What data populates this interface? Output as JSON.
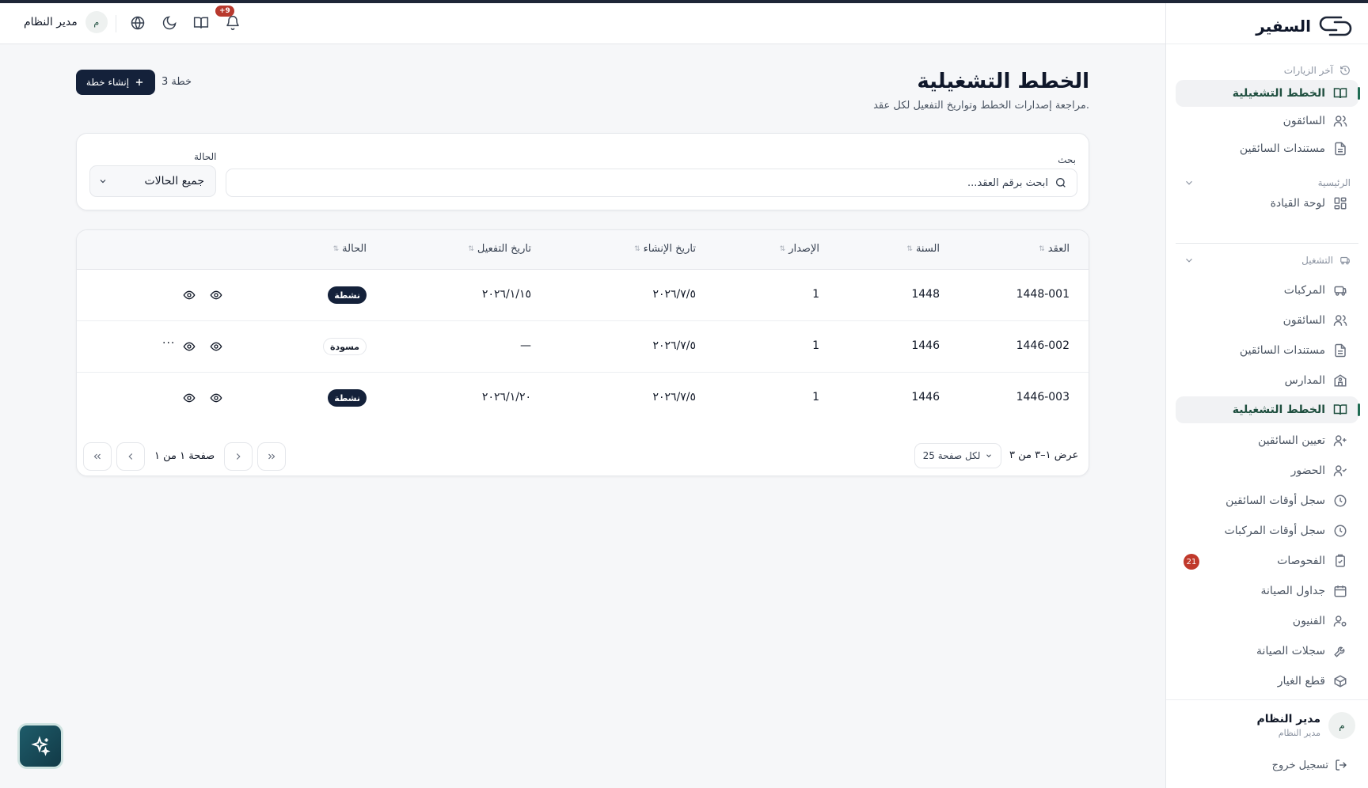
{
  "brand": {
    "name": "السفير"
  },
  "topbar": {
    "user_name": "مدير النظام",
    "user_initial": "م",
    "notification_badge": "+9"
  },
  "sidebar": {
    "recent_label": "آخر الزيارات",
    "recent_items": [
      {
        "label": "الخطط التشغيلية",
        "icon": "book-open-icon",
        "active": true
      },
      {
        "label": "السائقون",
        "icon": "users-icon"
      },
      {
        "label": "مستندات السائقين",
        "icon": "file-text-icon"
      }
    ],
    "main_label": "الرئيسية",
    "main_items": [
      {
        "label": "لوحة القيادة",
        "icon": "dashboard-grid-icon"
      }
    ],
    "ops_label": "التشغيل",
    "ops_items": [
      {
        "label": "المركبات",
        "icon": "bus-icon"
      },
      {
        "label": "السائقون",
        "icon": "users-icon"
      },
      {
        "label": "مستندات السائقين",
        "icon": "file-text-icon"
      },
      {
        "label": "المدارس",
        "icon": "school-icon"
      },
      {
        "label": "الخطط التشغيلية",
        "icon": "book-open-icon",
        "active": true
      },
      {
        "label": "تعيين السائقين",
        "icon": "user-assign-icon"
      },
      {
        "label": "الحضور",
        "icon": "user-check-icon"
      },
      {
        "label": "سجل أوقات السائقين",
        "icon": "clock-icon"
      },
      {
        "label": "سجل أوقات المركبات",
        "icon": "clock-icon"
      },
      {
        "label": "الفحوصات",
        "icon": "clipboard-check-icon",
        "badge": "21"
      },
      {
        "label": "جداول الصيانة",
        "icon": "calendar-icon"
      },
      {
        "label": "الفنيون",
        "icon": "user-cog-icon"
      },
      {
        "label": "سجلات الصيانة",
        "icon": "wrench-icon"
      },
      {
        "label": "قطع الغيار",
        "icon": "package-icon"
      }
    ],
    "user": {
      "name": "مدير النظام",
      "role": "مدير النظام",
      "initial": "م"
    },
    "logout_label": "تسجيل خروج"
  },
  "page": {
    "title": "الخطط التشغيلية",
    "subtitle": "مراجعة إصدارات الخطط وتواريخ التفعيل لكل عقد.",
    "create_button": "إنشاء خطة",
    "plan_count": "3 خطة"
  },
  "filters": {
    "search_label": "بحث",
    "search_placeholder": "ابحث برقم العقد...",
    "status_label": "الحالة",
    "status_value": "جميع الحالات"
  },
  "table": {
    "headers": {
      "contract": "العقد",
      "year": "السنة",
      "version": "الإصدار",
      "created": "تاريخ الإنشاء",
      "activated": "تاريخ التفعيل",
      "status": "الحالة"
    },
    "rows": [
      {
        "contract": "1448-001",
        "year": "1448",
        "version": "1",
        "created": "٢٠٢٦/٧/٥",
        "activated": "٢٠٢٦/١/١٥",
        "status": "نشطة",
        "status_kind": "active"
      },
      {
        "contract": "1446-002",
        "year": "1446",
        "version": "1",
        "created": "٢٠٢٦/٧/٥",
        "activated": "—",
        "status": "مسودة",
        "status_kind": "draft"
      },
      {
        "contract": "1446-003",
        "year": "1446",
        "version": "1",
        "created": "٢٠٢٦/٧/٥",
        "activated": "٢٠٢٦/١/٢٠",
        "status": "نشطة",
        "status_kind": "active"
      }
    ],
    "more_glyph": "···"
  },
  "pagination": {
    "showing": "عرض ١–٣ من ٣",
    "per_page": "25 لكل صفحة",
    "page_text": "صفحة ١ من ١"
  },
  "colors": {
    "primary_dark": "#14213a",
    "accent_green": "#1f6b52",
    "badge_red": "#c0392b"
  }
}
